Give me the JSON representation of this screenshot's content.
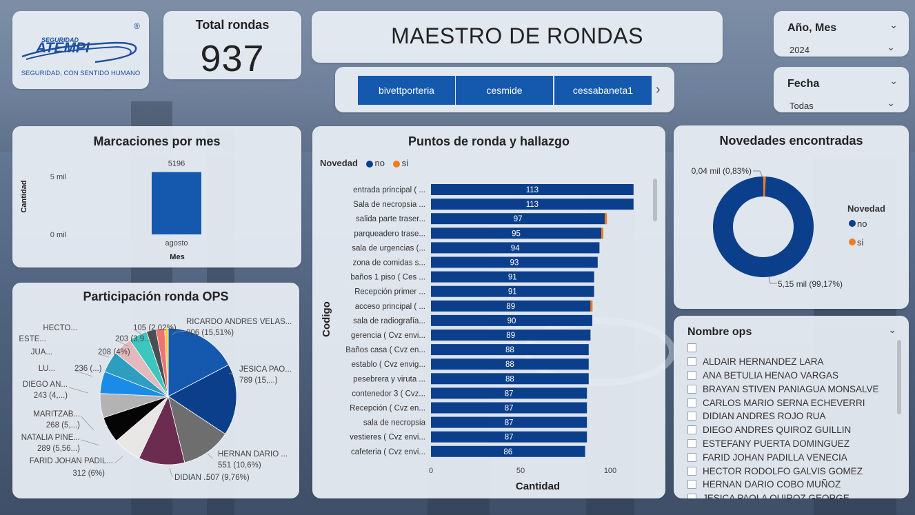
{
  "kpi": {
    "label": "Total rondas",
    "value": "937"
  },
  "title": "MAESTRO DE RONDAS",
  "logo": {
    "top": "SEGURIDAD",
    "main": "ATEMPI",
    "reg": "®",
    "subtitle": "SEGURIDAD, CON SENTIDO HUMANO"
  },
  "tabs": [
    "bivettporteria",
    "cesmide",
    "cessabaneta1"
  ],
  "slicers": {
    "year_month": {
      "label": "Año, Mes",
      "value": "2024"
    },
    "fecha": {
      "label": "Fecha",
      "value": "Todas"
    }
  },
  "colors": {
    "no": "#0b3f8c",
    "si": "#f07c1e",
    "tab": "#1459ad",
    "bar_month": "#1459ad"
  },
  "marcaciones": {
    "title": "Marcaciones por mes",
    "ylabel": "Cantidad",
    "xlabel": "Mes",
    "y_ticks": [
      "5 mil",
      "0 mil"
    ],
    "chart_data": {
      "type": "bar",
      "categories": [
        "agosto"
      ],
      "values": [
        5196
      ],
      "data_labels": [
        "5196"
      ],
      "ylim": [
        0,
        5300
      ]
    }
  },
  "puntos": {
    "title": "Puntos de ronda y hallazgo",
    "legend_title": "Novedad",
    "legend": [
      "no",
      "si"
    ],
    "ylabel": "Codigo",
    "xlabel": "Cantidad",
    "x_ticks": [
      "0",
      "50",
      "100"
    ],
    "chart_data": {
      "type": "bar",
      "orientation": "horizontal",
      "stacked": true,
      "categories": [
        "entrada principal ( ...",
        "Sala de necropsia ...",
        "salida parte traser...",
        "parqueadero trase...",
        "sala de urgencias (...",
        "zona de comidas s...",
        "baños 1 piso ( Ces ...",
        "Recepción primer ...",
        "acceso principal ( ...",
        "sala de radiografía...",
        "gerencia ( Cvz envi...",
        "Baños casa ( Cvz en...",
        "establo ( Cvz envig...",
        "pesebrera y viruta ...",
        "contenedor 3 ( Cvz...",
        "Recepción ( Cvz en...",
        "sala de necropsia",
        "vestieres ( Cvz envi...",
        "cafeteria ( Cvz envi..."
      ],
      "series": [
        {
          "name": "no",
          "values": [
            113,
            113,
            97,
            95,
            94,
            93,
            91,
            91,
            89,
            90,
            89,
            88,
            88,
            88,
            87,
            87,
            87,
            87,
            86
          ]
        },
        {
          "name": "si",
          "values": [
            0,
            0,
            1,
            1,
            0,
            0,
            0,
            0,
            1,
            0,
            0,
            0,
            0,
            0,
            0,
            0,
            0,
            0,
            0
          ]
        }
      ],
      "data_labels": [
        "113",
        "113",
        "97",
        "95",
        "94",
        "93",
        "91",
        "91",
        "89",
        "90",
        "89",
        "88",
        "88",
        "88",
        "87",
        "87",
        "87",
        "87",
        "86"
      ],
      "xlim": [
        0,
        115
      ]
    }
  },
  "novedades": {
    "title": "Novedades encontradas",
    "legend_title": "Novedad",
    "legend": [
      "no",
      "si"
    ],
    "chart_data": {
      "type": "pie",
      "donut": true,
      "labels": [
        "no",
        "si"
      ],
      "values": [
        5150,
        40
      ],
      "data_labels": [
        "5,15 mil (99,17%)",
        "0,04 mil (0,83%)"
      ]
    }
  },
  "participacion": {
    "title": "Participación ronda OPS",
    "chart_data": {
      "type": "pie",
      "labels": [
        "RICARDO ANDRES VELAS...",
        "JESICA PAO...",
        "HERNAN DARIO ...",
        "DIDIAN ...",
        "FARID JOHAN PADIL...",
        "NATALIA PINE...",
        "MARITZAB...",
        "DIEGO AN...",
        "LU...",
        "JUA...",
        "ESTE...",
        "HECTO...",
        "",
        ""
      ],
      "values": [
        806,
        789,
        551,
        507,
        312,
        289,
        268,
        243,
        236,
        208,
        203,
        105,
        95,
        40
      ],
      "colors": [
        "#1459ad",
        "#0b3f8c",
        "#6e6e6e",
        "#6b2c4f",
        "#e9e6e6",
        "#050505",
        "#b3b3b3",
        "#1a8ce8",
        "#2e9ec0",
        "#e3b9bd",
        "#3dc6be",
        "#4a4f55",
        "#ef7373",
        "#f2cb3c"
      ],
      "data_labels": [
        "806 (15,51%)",
        "789 (15,...)",
        "551 (10,6%)",
        "507 (9,76%)",
        "312 (6%)",
        "289 (5,56...)",
        "268 (5,...)",
        "243 (4,...)",
        "236 (...)",
        "208 (4%)",
        "203 (3,9...)",
        "105 (2,02%)"
      ]
    }
  },
  "ops": {
    "title": "Nombre ops",
    "items": [
      "",
      "ALDAIR HERNANDEZ LARA",
      "ANA BETULIA HENAO VARGAS",
      "BRAYAN STIVEN PANIAGUA MONSALVE",
      "CARLOS MARIO SERNA ECHEVERRI",
      "DIDIAN ANDRES ROJO RUA",
      "DIEGO ANDRES QUIROZ GUILLIN",
      "ESTEFANY PUERTA DOMINGUEZ",
      "FARID JOHAN PADILLA VENECIA",
      "HECTOR RODOLFO GALVIS GOMEZ",
      "HERNAN DARIO COBO MUÑOZ",
      "JESICA PAOLA QUIROZ GEORGE"
    ]
  }
}
